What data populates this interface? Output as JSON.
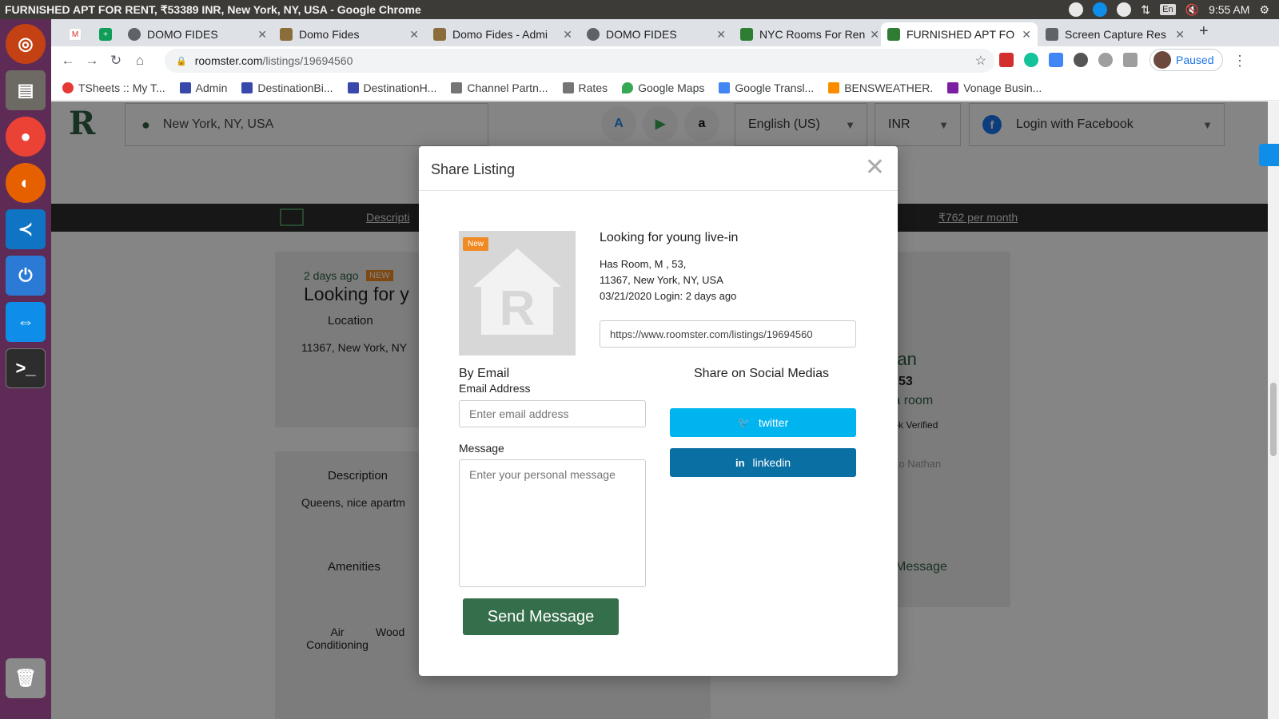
{
  "window": {
    "title": "FURNISHED APT FOR RENT, ₹53389 INR, New York, NY, USA - Google Chrome"
  },
  "system_tray": {
    "lang": "En",
    "time": "9:55 AM"
  },
  "tabs": [
    {
      "label": "",
      "color": "#ffffff",
      "icon": "gmail-icon"
    },
    {
      "label": "",
      "color": "#0f9d58",
      "icon": "sheets-icon"
    },
    {
      "label": "DOMO FIDES",
      "color": "#5f6368",
      "icon": "globe-icon"
    },
    {
      "label": "Domo Fides",
      "color": "#8a6d3b",
      "icon": "site-icon"
    },
    {
      "label": "Domo Fides - Admi",
      "color": "#8a6d3b",
      "icon": "site-icon"
    },
    {
      "label": "DOMO FIDES",
      "color": "#5f6368",
      "icon": "globe-icon"
    },
    {
      "label": "NYC Rooms For Ren",
      "color": "#2e7d32",
      "icon": "roomster-icon"
    },
    {
      "label": "FURNISHED APT FO",
      "color": "#2e7d32",
      "icon": "roomster-icon"
    },
    {
      "label": "Screen Capture Res",
      "color": "#5f6368",
      "icon": "camera-icon"
    }
  ],
  "address_bar": {
    "domain": "roomster.com",
    "path": "/listings/19694560"
  },
  "profile": {
    "label": "Paused"
  },
  "bookmarks": [
    {
      "label": "TSheets :: My T...",
      "color": "#e53935"
    },
    {
      "label": "Admin",
      "color": "#3949ab"
    },
    {
      "label": "DestinationBi...",
      "color": "#3949ab"
    },
    {
      "label": "DestinationH...",
      "color": "#3949ab"
    },
    {
      "label": "Channel Partn...",
      "color": "#757575"
    },
    {
      "label": "Rates",
      "color": "#757575"
    },
    {
      "label": "Google Maps",
      "color": "#34a853"
    },
    {
      "label": "Google Transl...",
      "color": "#4285f4"
    },
    {
      "label": "BENSWEATHER.",
      "color": "#fb8c00"
    },
    {
      "label": "Vonage Busin...",
      "color": "#7b1fa2"
    }
  ],
  "site": {
    "location": "New York, NY, USA",
    "language": "English (US)",
    "currency": "INR",
    "login": "Login with Facebook",
    "nav_description": "Descripti",
    "price": "₹762  per month",
    "posted": "2 days ago",
    "new_badge": "NEW",
    "title_partial": "Looking for y",
    "location_label": "Location",
    "address_partial": "11367, New York, NY",
    "description_label": "Description",
    "description_partial": "Queens, nice apartm",
    "amenities_label": "Amenities",
    "amenity1": "Air Conditioning",
    "amenity2": "Wood",
    "owner_partial": "than",
    "owner_age": "53",
    "owner_status": "g a room",
    "owner_verified": "book Verified",
    "msg_placeholder": "e to Nathan",
    "msg_button": "Message"
  },
  "modal": {
    "title": "Share Listing",
    "thumb_tag": "New",
    "listing_name": "Looking for young live-in",
    "details": [
      "Has Room, M , 53,",
      "11367, New York, NY, USA",
      "03/21/2020 Login: 2 days ago"
    ],
    "url": "https://www.roomster.com/listings/19694560",
    "by_email": "By Email",
    "email_label": "Email Address",
    "email_placeholder": "Enter email address",
    "message_label": "Message",
    "message_placeholder": "Enter your personal message",
    "send_button": "Send Message",
    "share_heading": "Share on Social Medias",
    "twitter": "twitter",
    "linkedin": "linkedin"
  },
  "colors": {
    "twitter": "#00b4f0",
    "linkedin": "#0a6fa3",
    "send": "#356e4a",
    "brand": "#2e5e42"
  }
}
